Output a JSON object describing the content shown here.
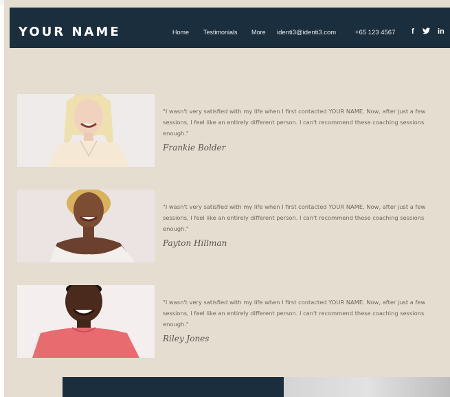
{
  "header": {
    "brand": "YOUR NAME",
    "nav": {
      "home": "Home",
      "testimonials": "Testimonials",
      "more": "More"
    },
    "email": "identi3@identi3.com",
    "phone": "+65 123 4567",
    "social": {
      "facebook": "f",
      "twitter": "🐦",
      "linkedin": "in"
    }
  },
  "testimonials": [
    {
      "quote": "\"I wasn't very satisfied with my life when I first contacted YOUR NAME. Now, after just a few sessions, I feel like an entirely different person. I can't recommend these coaching sessions enough.\"",
      "author": "Frankie Bolder"
    },
    {
      "quote": "\"I wasn't very satisfied with my life when I first contacted YOUR NAME. Now, after just a few sessions, I feel like an entirely different person. I can't recommend these coaching sessions enough.\"",
      "author": "Payton Hillman"
    },
    {
      "quote": "\"I wasn't very satisfied with my life when I first contacted YOUR NAME. Now, after just a few sessions, I feel like an entirely different person. I can't recommend these coaching sessions enough.\"",
      "author": "Riley Jones"
    }
  ],
  "colors": {
    "header_bg": "#1b2e3d",
    "page_bg": "#e4ddd0",
    "quote_text": "#6d665d"
  }
}
